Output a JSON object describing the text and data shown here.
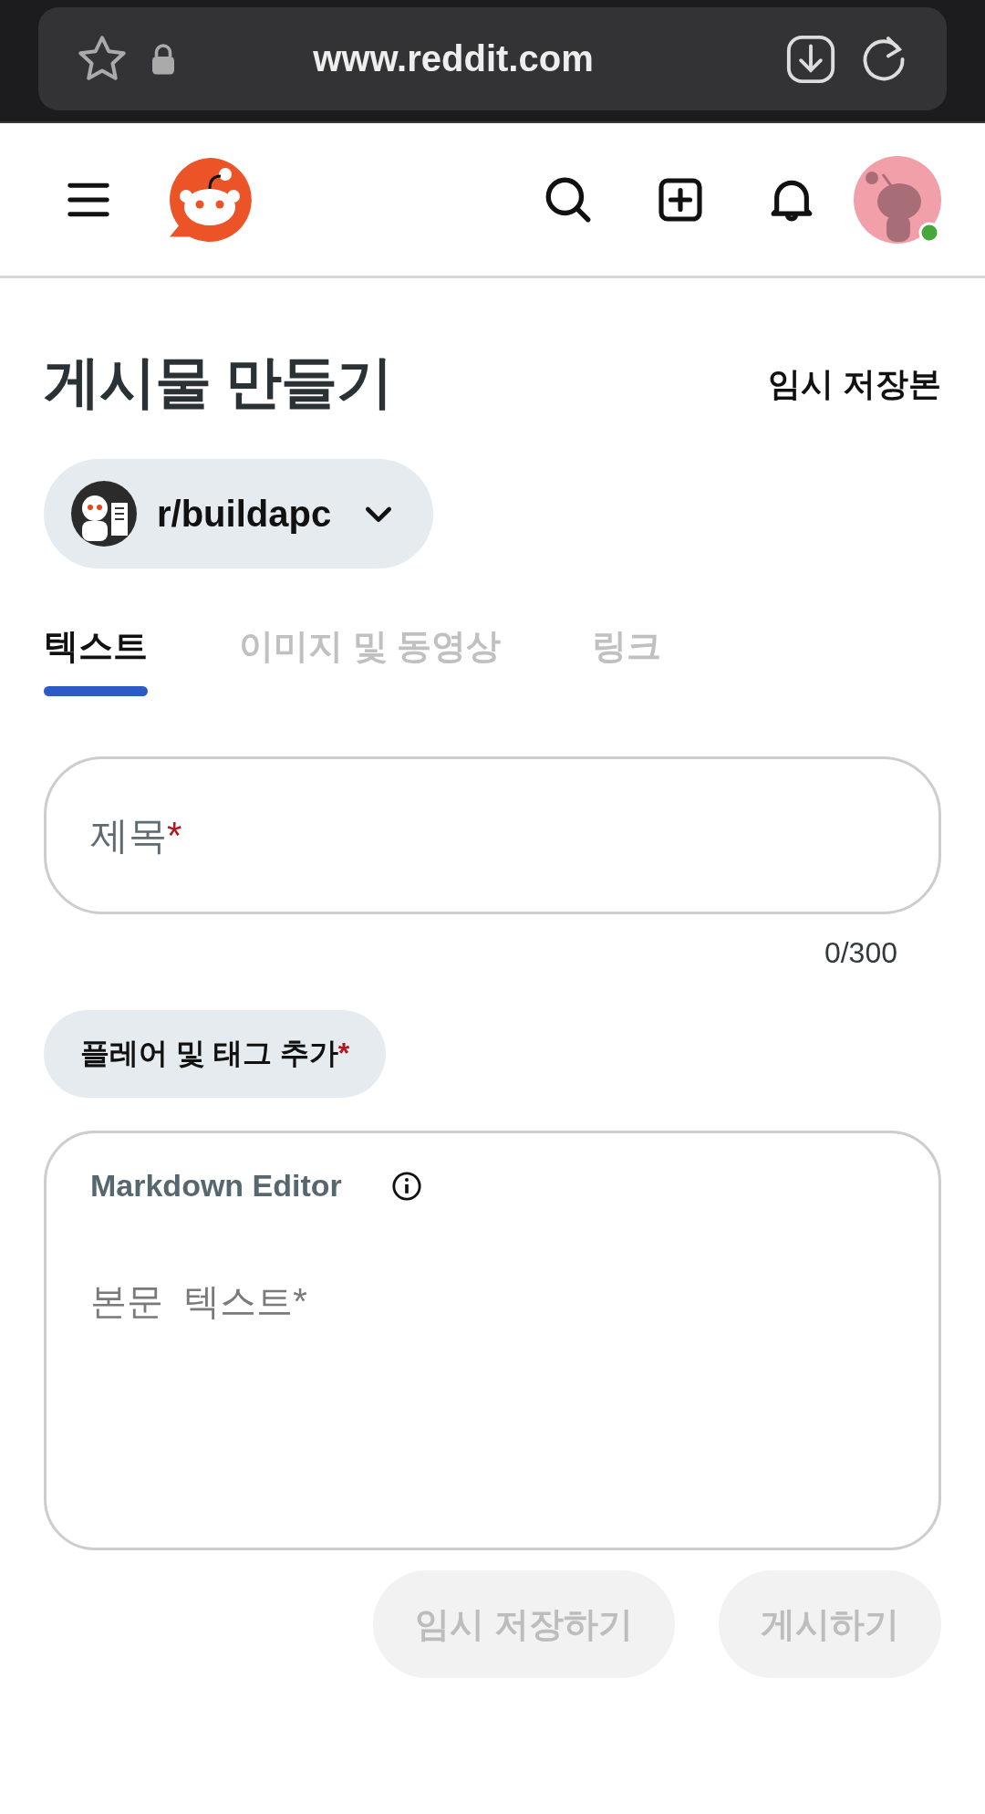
{
  "browser": {
    "url": "www.reddit.com"
  },
  "page": {
    "title": "게시물 만들기",
    "drafts_link": "임시 저장본"
  },
  "community": {
    "name": "r/buildapc"
  },
  "tabs": [
    {
      "label": "텍스트",
      "selected": true
    },
    {
      "label": "이미지 및 동영상",
      "selected": false
    },
    {
      "label": "링크",
      "selected": false
    }
  ],
  "title_field": {
    "placeholder": "제목",
    "required_mark": "*",
    "counter": "0/300"
  },
  "flair_button": {
    "label": "플레어 및 태그 추가",
    "required_mark": "*"
  },
  "editor": {
    "mode_label": "Markdown Editor",
    "placeholder": "본문  텍스트*"
  },
  "buttons": [
    {
      "label": "임시 저장하기",
      "disabled": true
    },
    {
      "label": "게시하기",
      "disabled": true
    }
  ]
}
